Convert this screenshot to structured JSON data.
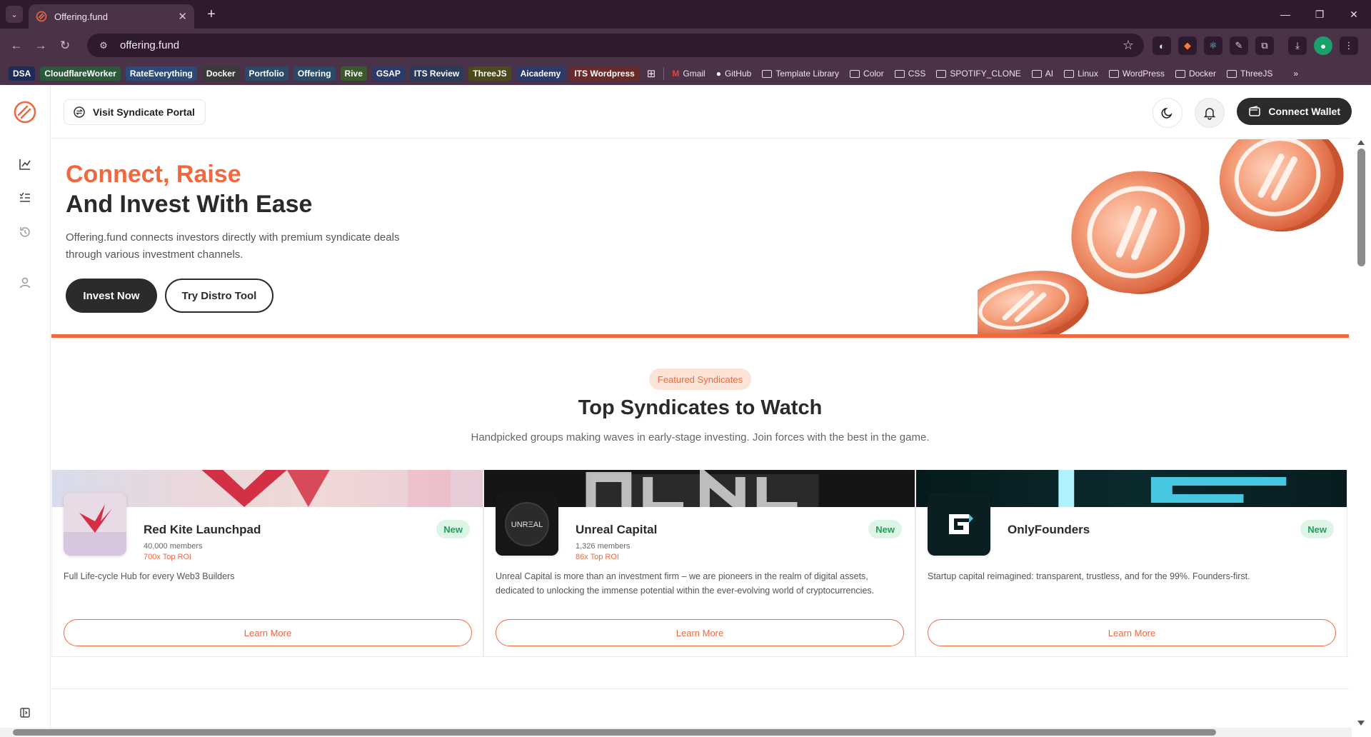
{
  "browser": {
    "tab_title": "Offering.fund",
    "url": "offering.fund",
    "bookmarks_chips": [
      {
        "label": "DSA",
        "bg": "#1e2a5a"
      },
      {
        "label": "CloudflareWorker",
        "bg": "#2a5a3a"
      },
      {
        "label": "RateEverything",
        "bg": "#2a4a7a"
      },
      {
        "label": "Docker",
        "bg": "#3a3a3a"
      },
      {
        "label": "Portfolio",
        "bg": "#2a4a6a"
      },
      {
        "label": "Offering",
        "bg": "#2a4a6a"
      },
      {
        "label": "Rive",
        "bg": "#3a5a2a"
      },
      {
        "label": "GSAP",
        "bg": "#2a3a6a"
      },
      {
        "label": "ITS Review",
        "bg": "#2a3a5a"
      },
      {
        "label": "ThreeJS",
        "bg": "#4a4a1a"
      },
      {
        "label": "Aicademy",
        "bg": "#2a3a6a"
      },
      {
        "label": "ITS Wordpress",
        "bg": "#6a2a2a"
      }
    ],
    "bookmarks_links": [
      "Gmail",
      "GitHub",
      "Template Library"
    ],
    "bookmarks_folders": [
      "Color",
      "CSS",
      "SPOTIFY_CLONE",
      "AI",
      "Linux",
      "WordPress",
      "Docker",
      "ThreeJS"
    ],
    "bookmarks_more": "»"
  },
  "topbar": {
    "portal_label": "Visit Syndicate Portal",
    "wallet_label": "Connect Wallet"
  },
  "hero": {
    "headline_accent": "Connect, Raise",
    "headline_main": "And Invest With Ease",
    "description": "Offering.fund connects investors directly with premium syndicate deals through various investment channels.",
    "primary_cta": "Invest Now",
    "secondary_cta": "Try Distro Tool"
  },
  "featured": {
    "badge": "Featured Syndicates",
    "title": "Top Syndicates to Watch",
    "subtitle": "Handpicked groups making waves in early-stage investing. Join forces with the best in the game."
  },
  "cards": [
    {
      "name": "Red Kite Launchpad",
      "members": "40,000 members",
      "roi": "700x Top ROI",
      "badge": "New",
      "description": "Full Life-cycle Hub for every Web3 Builders",
      "cta": "Learn More"
    },
    {
      "name": "Unreal Capital",
      "members": "1,326 members",
      "roi": "86x Top ROI",
      "badge": "New",
      "avatar_text": "UNRΞAL",
      "description": "Unreal Capital is more than an investment firm – we are pioneers in the realm of digital assets, dedicated to unlocking the immense potential within the ever-evolving world of cryptocurrencies.",
      "cta": "Learn More"
    },
    {
      "name": "OnlyFounders",
      "badge": "New",
      "description": "Startup capital reimagined: transparent, trustless, and for the 99%. Founders-first.",
      "cta": "Learn More"
    }
  ],
  "colors": {
    "accent": "#f0683e",
    "dark": "#2b2b2b",
    "badge_green": "#22a05a"
  }
}
